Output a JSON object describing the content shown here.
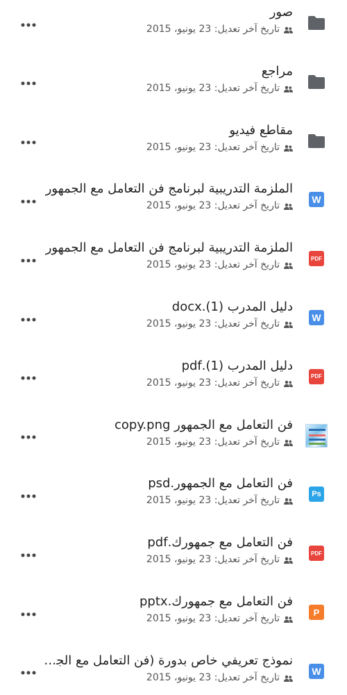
{
  "meta_prefix": "تاريخ آخر تعديل: ",
  "modified_date": "23 يونيو، 2015",
  "items": [
    {
      "title": "صور",
      "type": "folder"
    },
    {
      "title": "مراجع",
      "type": "folder"
    },
    {
      "title": "مقاطع فيديو",
      "type": "folder"
    },
    {
      "title": "الملزمة التدريبية لبرنامج فن التعامل مع الجمهور",
      "type": "word",
      "badge": "W"
    },
    {
      "title": "الملزمة التدريبية لبرنامج فن التعامل مع الجمهور",
      "type": "pdf",
      "badge": "PDF"
    },
    {
      "title": "دليل المدرب (1).docx",
      "type": "word",
      "badge": "W"
    },
    {
      "title": "دليل المدرب (1).pdf",
      "type": "pdf",
      "badge": "PDF"
    },
    {
      "title": "فن التعامل مع الجمهور copy.png",
      "type": "image"
    },
    {
      "title": "فن التعامل مع الجمهور.psd",
      "type": "ps",
      "badge": "Ps"
    },
    {
      "title": "فن التعامل مع جمهورك.pdf",
      "type": "pdf",
      "badge": "PDF"
    },
    {
      "title": "فن التعامل مع جمهورك.pptx",
      "type": "ppt",
      "badge": "P"
    },
    {
      "title": "نموذج تعريفي خاص بدورة (فن التعامل مع الجمهور)",
      "type": "word",
      "badge": "W"
    }
  ],
  "colors": {
    "folder": "#5f6368",
    "word": "#4a8fe7",
    "pdf": "#e8453c",
    "ps": "#2ba5e8",
    "ppt": "#f57c2b"
  }
}
